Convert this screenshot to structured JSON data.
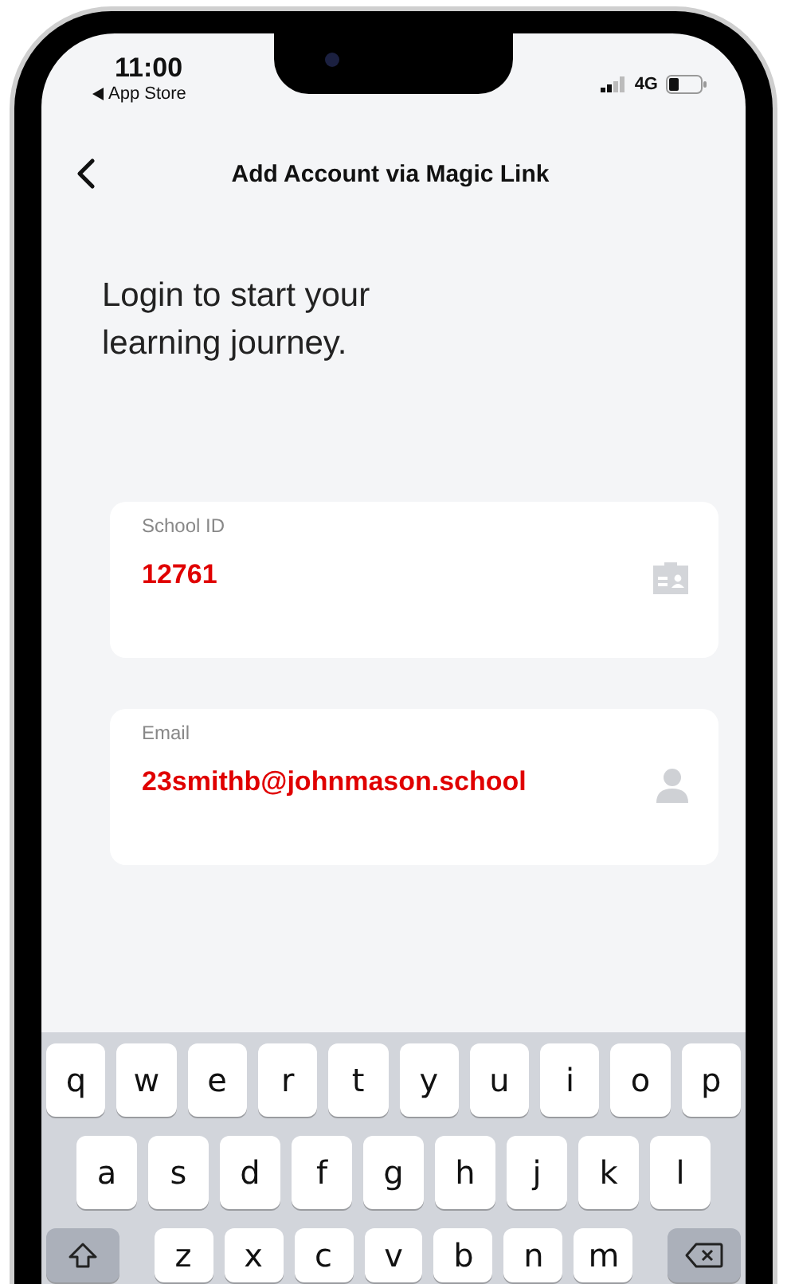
{
  "status_bar": {
    "time": "11:00",
    "back_app": "App Store",
    "network": "4G"
  },
  "nav": {
    "title": "Add Account via Magic Link"
  },
  "heading": "Login to start your learning journey.",
  "fields": [
    {
      "label": "School ID",
      "value": "12761",
      "kind": "id"
    },
    {
      "label": "Email",
      "value": "23smithb@johnmason.school",
      "kind": "person"
    }
  ],
  "keyboard": {
    "rows": [
      [
        "q",
        "w",
        "e",
        "r",
        "t",
        "y",
        "u",
        "i",
        "o",
        "p"
      ],
      [
        "a",
        "s",
        "d",
        "f",
        "g",
        "h",
        "j",
        "k",
        "l"
      ],
      [
        "z",
        "x",
        "c",
        "v",
        "b",
        "n",
        "m"
      ]
    ]
  }
}
